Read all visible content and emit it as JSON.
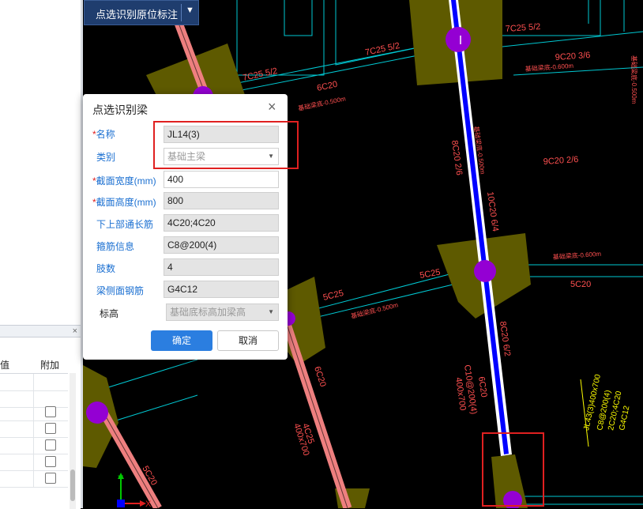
{
  "toolbar": {
    "button_label": "点选识别原位标注",
    "dropdown_icon": "triangle-down-icon"
  },
  "left_grid": {
    "column_a": "值",
    "column_b": "附加",
    "close_glyph": "×"
  },
  "dialog": {
    "title": "点选识别梁",
    "close_glyph": "×",
    "fields": {
      "name": {
        "label": "名称",
        "value": "JL14(3)",
        "required": true
      },
      "category": {
        "label": "类别",
        "placeholder": "基础主梁",
        "required": false
      },
      "section_width": {
        "label": "截面宽度(mm)",
        "value": "400",
        "required": true
      },
      "section_height": {
        "label": "截面高度(mm)",
        "value": "800",
        "required": true
      },
      "long_rebar": {
        "label": "下上部通长筋",
        "value": "4C20;4C20"
      },
      "stirrup": {
        "label": "箍筋信息",
        "value": "C8@200(4)"
      },
      "legs": {
        "label": "肢数",
        "value": "4"
      },
      "side_rebar": {
        "label": "梁侧面钢筋",
        "value": "G4C12"
      },
      "elevation": {
        "label": "标高",
        "placeholder": "基础底标高加梁高"
      }
    },
    "ok_label": "确定",
    "cancel_label": "取消"
  },
  "cad": {
    "annotations": {
      "a1": "7C25 5/2",
      "a2": "7C25 5/2",
      "a3": "7C25 5/2",
      "a4": "9C20 3/6",
      "a5": "6C20",
      "a6": "8C20 2/6",
      "a7": "10C20 6/4",
      "a8": "9C20 2/6",
      "a9": "5C25",
      "a10": "5C20",
      "a11": "5C25",
      "a12": "8C20 6/2",
      "a13": "C10@200(4)",
      "a14": "400x700",
      "a15": "6C20",
      "a16": "6C20",
      "a17": "4C25",
      "a18": "400x700",
      "a19": "5C20",
      "a20": "JL43(3)400x700",
      "a21": "C8@200(4)",
      "a22": "2C20;4C20",
      "a23": "G4C12",
      "e1": "基础梁底-0.600m",
      "e2": "基础梁底-0.500m",
      "e3": "基础梁底-0.500m",
      "e4": "基础梁底-0.600m",
      "e5": "基础梁底-0.500m",
      "e6": "基础梁底-0.500m"
    },
    "axis": {
      "x_label": "X",
      "y_label": "Y"
    }
  },
  "colors": {
    "cad_background": "#000000",
    "axis_line": "#00c8d2",
    "main_beam": "#0000ff",
    "beam_pink": "#ee7f7f",
    "column_olive": "#5e5a00",
    "node_purple": "#9400d3",
    "annotation_red": "#ff5050",
    "annotation_yellow": "#ffff00",
    "highlight_red": "#e02020",
    "primary_button": "#2b7ee0"
  }
}
